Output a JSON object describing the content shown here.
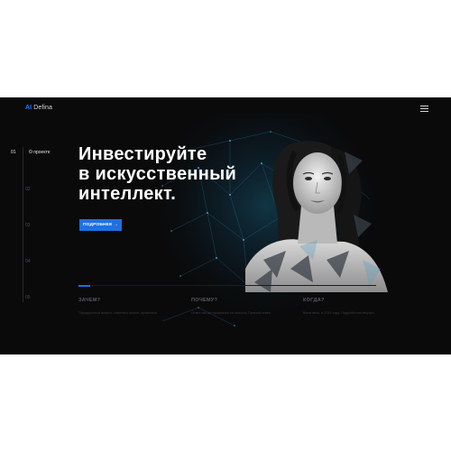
{
  "header": {
    "logo_ai": "AI",
    "logo_name": "Defina",
    "menu_icon": "hamburger-menu-icon"
  },
  "sidebar": {
    "items": [
      {
        "num": "01",
        "label": "О проекте",
        "active": true
      },
      {
        "num": "02",
        "label": "",
        "active": false
      },
      {
        "num": "03",
        "label": "",
        "active": false
      },
      {
        "num": "04",
        "label": "",
        "active": false
      },
      {
        "num": "05",
        "label": "",
        "active": false
      }
    ]
  },
  "hero": {
    "title_line1": "Инвестируйте",
    "title_line2": "в искусственный",
    "title_line3": "интеллект.",
    "cta_label": "ПОДРОБНЕЕ →",
    "slide_progress": 0.04
  },
  "columns": [
    {
      "heading": "ЗАЧЕМ?",
      "text": "Парадоксный вопрос, ответить лучше, прочитать."
    },
    {
      "heading": "ПОЧЕМУ?",
      "text": "Ответ так же прозрачен по смыслу. Прямой ответ."
    },
    {
      "heading": "КОГДА?",
      "text": "Всем весь, в 2019 году. Подробности внутри."
    }
  ],
  "colors": {
    "accent": "#1f6fe0",
    "background": "#0a0a0b",
    "page": "#ffffff"
  }
}
